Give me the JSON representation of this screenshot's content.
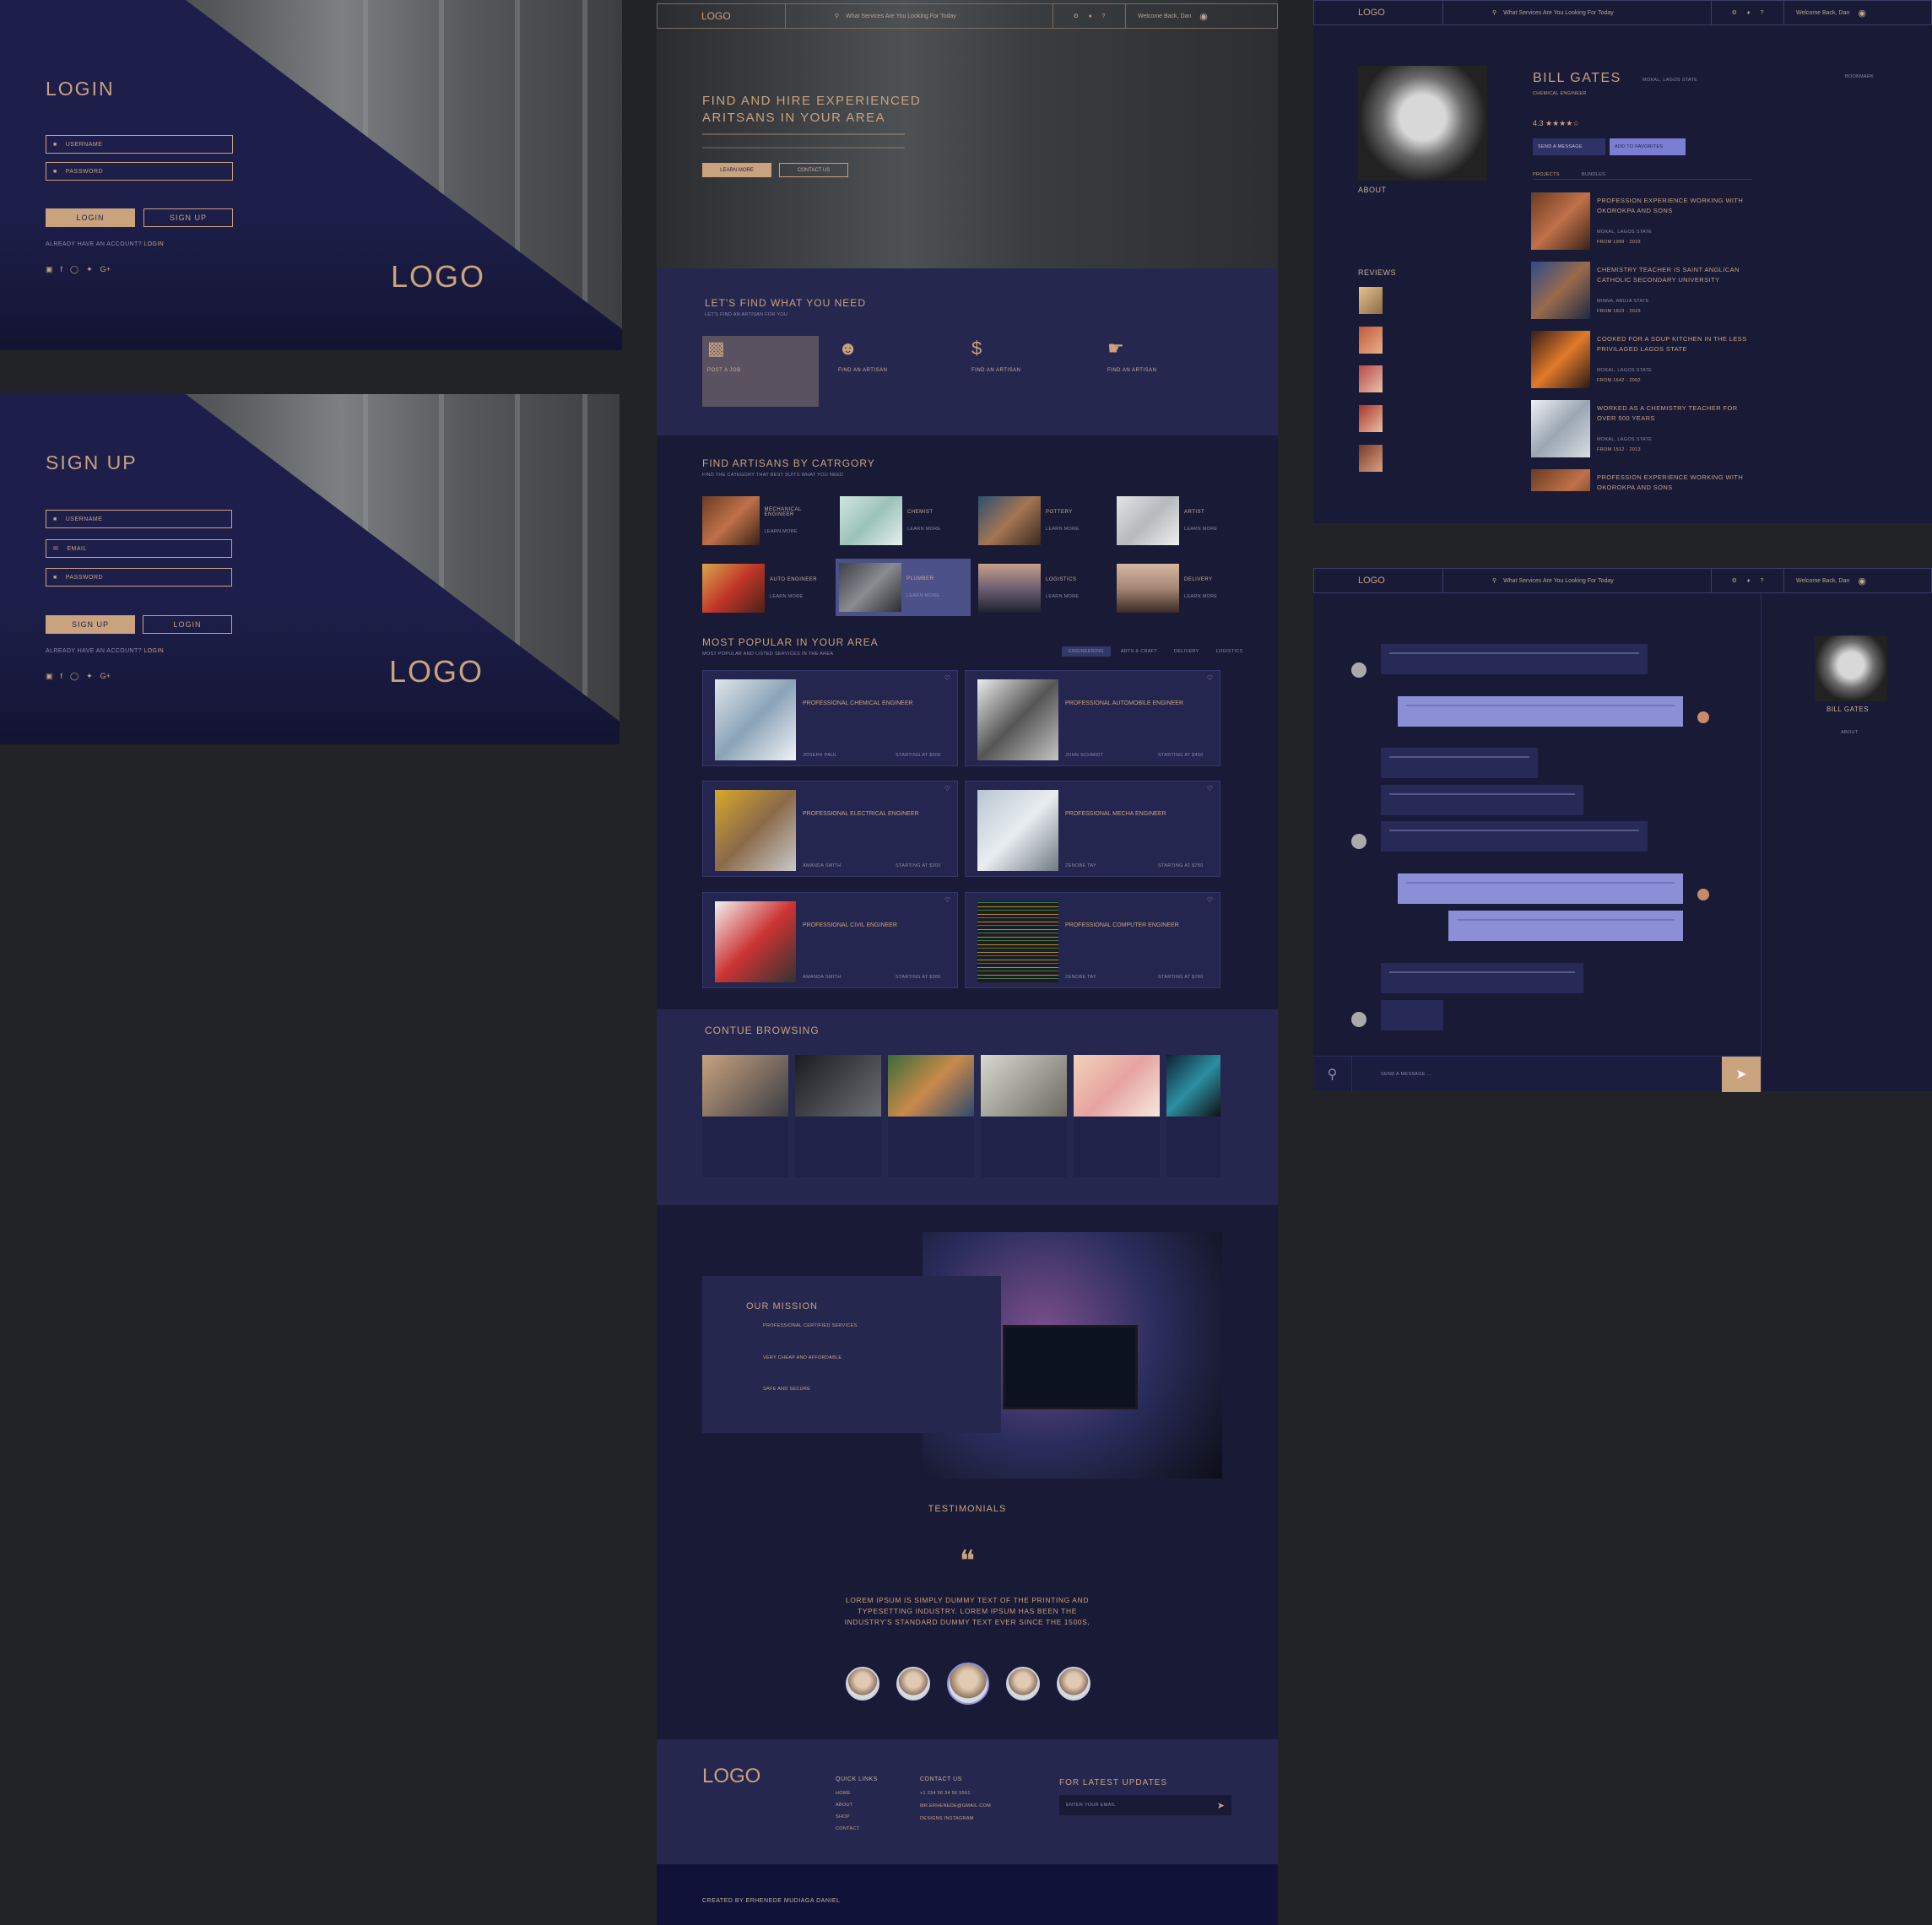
{
  "login": {
    "title": "LOGIN",
    "username_placeholder": "USERNAME",
    "password_placeholder": "PASSWORD",
    "login_btn": "LOGIN",
    "signup_btn": "SIGN UP",
    "note_prefix": "ALREADY HAVE AN ACCOUNT?",
    "note_link": "LOGIN",
    "logo": "LOGO"
  },
  "signup": {
    "title": "SIGN UP",
    "username_placeholder": "USERNAME",
    "email_placeholder": "EMAIL",
    "password_placeholder": "PASSWORD",
    "signup_btn": "SIGN UP",
    "login_btn": "LOGIN",
    "note_prefix": "ALREADY HAVE AN ACCOUNT?",
    "note_link": "LOGIN",
    "logo": "LOGO"
  },
  "nav": {
    "logo": "LOGO",
    "search_placeholder": "What Services Are You Looking For Today",
    "welcome": "Welcome Back, Dan"
  },
  "hero": {
    "title": "FIND AND HIRE EXPERIENCED ARITSANS IN YOUR AREA",
    "learn_more": "LEARN MORE",
    "contact_us": "CONTACT US"
  },
  "find": {
    "title": "LET'S FIND WHAT YOU NEED",
    "sub": "LET'S FIND AN ARTISAN FOR YOU",
    "cards": [
      {
        "icon": "briefcase-icon",
        "label": "POST A JOB"
      },
      {
        "icon": "user-icon",
        "label": "FIND AN ARTISAN"
      },
      {
        "icon": "dollar-icon",
        "label": "FIND AN ARTISAN"
      },
      {
        "icon": "handshake-icon",
        "label": "FIND AN ARTISAN"
      }
    ]
  },
  "categories": {
    "title": "FIND ARTISANS BY CATRGORY",
    "sub": "FIND THE CATEGORY THAT BEST SUITS WHAT YOU NEED",
    "items": [
      "MECHANICAL ENGINEER",
      "CHEMIST",
      "POTTERY",
      "ARTIST",
      "AUTO ENGINEER",
      "PLUMBER",
      "LOGISTICS",
      "DELIVERY"
    ],
    "learn_more": "LEARN MORE"
  },
  "popular": {
    "title": "MOST POPULAR IN YOUR AREA",
    "sub": "MOST POPULAR AND LISTED SERVICES IN THE AREA",
    "tabs": [
      "ENGINEERING",
      "ARTS & CRAFT",
      "DELIVERY",
      "LOGISTICS"
    ],
    "items": [
      {
        "title": "PROFESSIONAL CHEMICAL ENGINEER",
        "name": "JOSEPH PAUL",
        "price": "STARTING AT $500"
      },
      {
        "title": "PROFESSIONAL AUTOMOBILE ENGINEER",
        "name": "JOHN SCHMIDT",
        "price": "STARTING AT $450"
      },
      {
        "title": "PROFESSIONAL ELECTRICAL ENGINEER",
        "name": "AMANDA SMITH",
        "price": "STARTING AT $300"
      },
      {
        "title": "PROFESSIONAL MECHA ENGINEER",
        "name": "ZENOBE TAY",
        "price": "STARTING AT $780"
      },
      {
        "title": "PROFESSIONAL CIVIL ENGINEER",
        "name": "AMANDA SMITH",
        "price": "STARTING AT $380"
      },
      {
        "title": "PROFESSIONAL COMPUTER ENGINEER",
        "name": "ZENOBE TAY",
        "price": "STARTING AT $780"
      }
    ]
  },
  "browsing": {
    "title": "CONTUE BROWSING"
  },
  "mission": {
    "title": "OUR MISSION",
    "items": [
      "PROFESSIONAL CERTIFIED SERVICES",
      "VERY CHEAP AND AFFORDABLE",
      "SAFE AND SECURE"
    ]
  },
  "testimonials": {
    "title": "TESTIMONIALS",
    "quote": "LOREM IPSUM IS SIMPLY DUMMY TEXT OF THE PRINTING AND TYPESETTING INDUSTRY. LOREM IPSUM HAS BEEN THE INDUSTRY'S STANDARD DUMMY TEXT EVER SINCE THE 1500S,"
  },
  "footer": {
    "logo": "LOGO",
    "quick_links_title": "QUICK LINKS",
    "quick_links": [
      "HOME",
      "ABOUT",
      "SHOP",
      "CONTACT"
    ],
    "contact_title": "CONTACT US",
    "contact": [
      "+1 234 56 34 56 5561",
      "MR.ERHENEDE@GMAIL.COM",
      "DESIGNS INSTAGRAM"
    ],
    "updates_title": "FOR LATEST UPDATES",
    "email_placeholder": "ENTER YOUR EMAIL",
    "credit": "CREATED BY ERHENEDE MUDIAGA DANIEL"
  },
  "profile": {
    "name": "BILL GATES",
    "location": "MOKAL, LAGOS STATE",
    "role": "CHEMICAL ENGINEER",
    "rating": "4.3 ★★★★☆",
    "send_message": "SEND A MESSAGE",
    "add_favorites": "ADD TO FAVORITES",
    "tabs": [
      "PROJECTS",
      "BUNDLES"
    ],
    "about": "ABOUT",
    "reviews": "REVIEWS",
    "bookmark": "BOOKMARK",
    "projects": [
      {
        "title": "PROFESSION EXPERIENCE WORKING WITH OKOROKPA AND SONS",
        "loc": "MOKAL, LAGOS STATE",
        "years": "FROM 1999 - 2023"
      },
      {
        "title": "CHEMISTRY TEACHER IS SAINT ANGLICAN CATHOLIC SECONDARY UNIVERSITY",
        "loc": "MINNA, ABUJA STATE",
        "years": "FROM 1823 - 2023"
      },
      {
        "title": "COOKED FOR A SOUP KITCHEN IN THE LESS PRIVILAGED LAGOS STATE",
        "loc": "MOKAL, LAGOS STATE",
        "years": "FROM 1642 - 2002"
      },
      {
        "title": "WORKED AS A CHEMISTRY TEACHER FOR OVER 500 YEARS",
        "loc": "MOKAL, LAGOS STATE",
        "years": "FROM 1512 - 2013"
      },
      {
        "title": "PROFESSION EXPERIENCE WORKING WITH OKOROKPA AND SONS",
        "loc": "",
        "years": ""
      }
    ]
  },
  "chat": {
    "placeholder": "SEND A MESSAGE ...",
    "contact_name": "BILL GATES",
    "about": "ABOUT"
  },
  "colors": {
    "gold": "#c9a27e",
    "navy": "#181a36",
    "panel": "#24264f",
    "bubble_me": "#8c8fd6"
  }
}
